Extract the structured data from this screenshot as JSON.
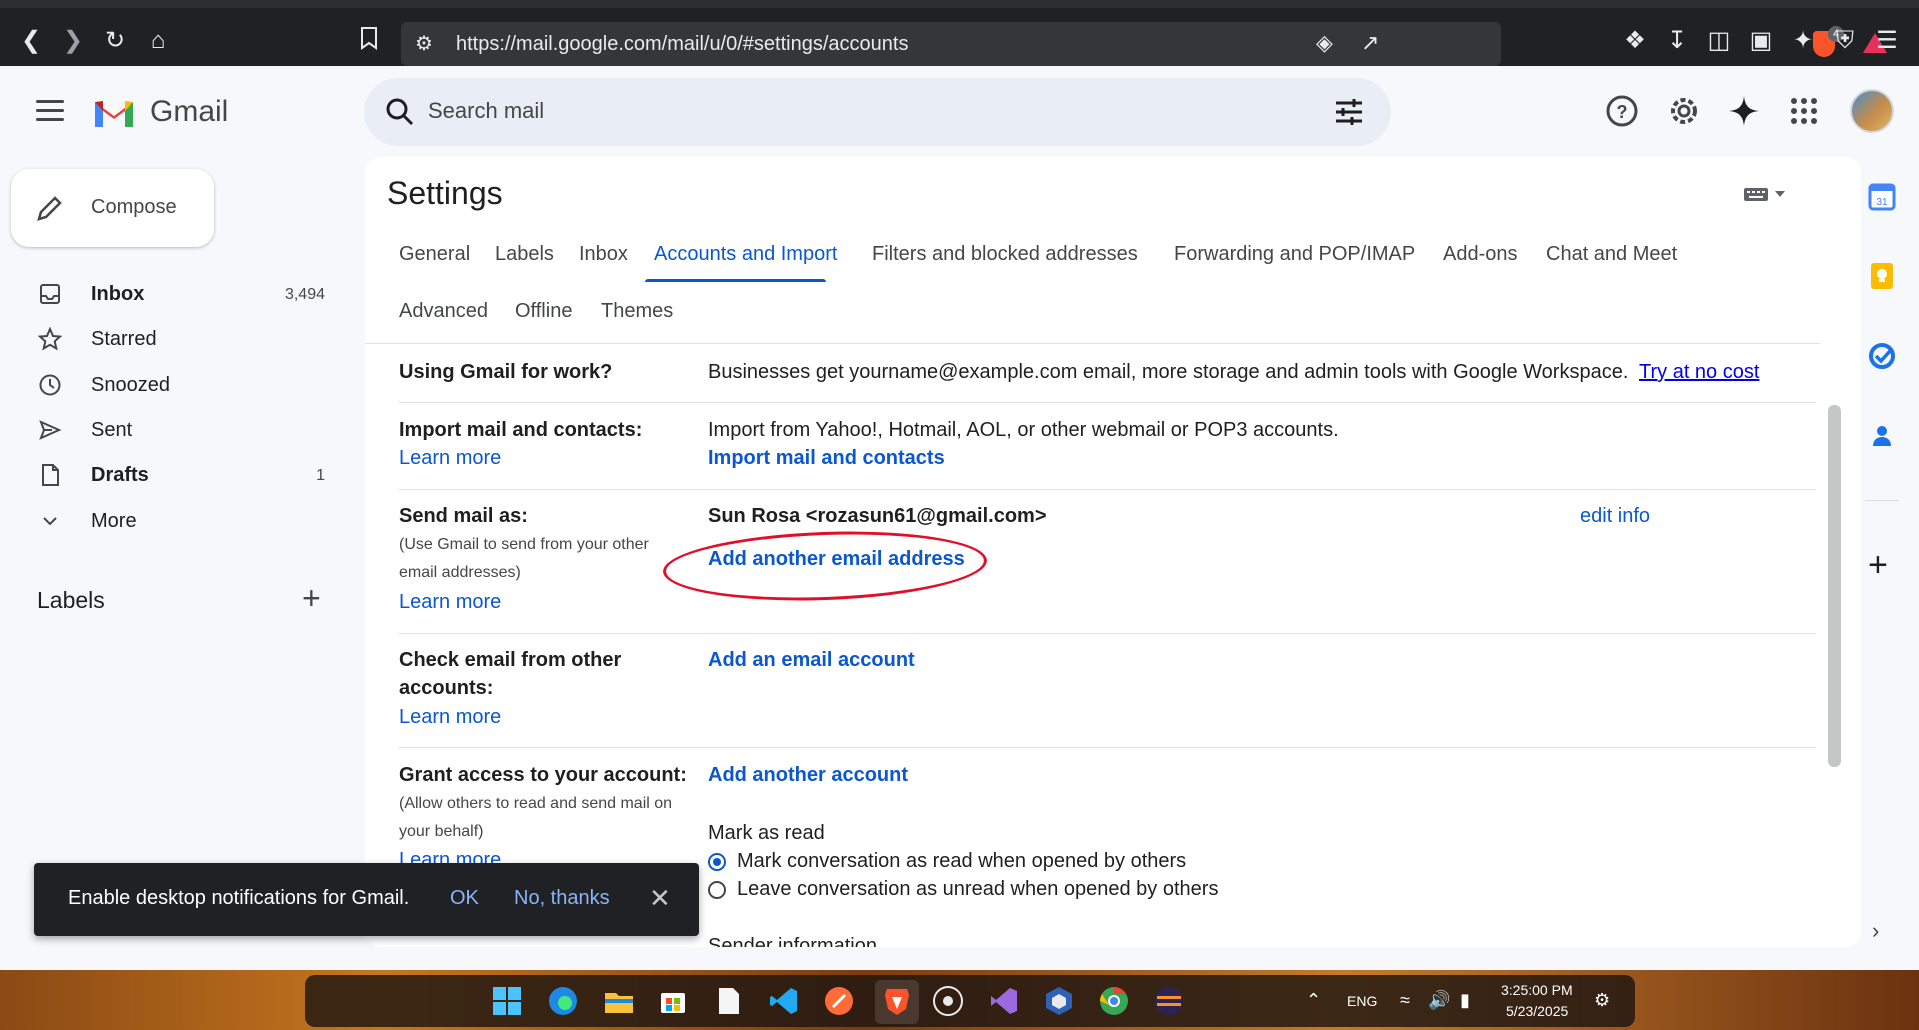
{
  "browser": {
    "url": "https://mail.google.com/mail/u/0/#settings/accounts",
    "shield_count": "4"
  },
  "header": {
    "app_name": "Gmail",
    "search_placeholder": "Search mail"
  },
  "sidebar": {
    "compose_label": "Compose",
    "items": [
      {
        "label": "Inbox",
        "count": "3,494"
      },
      {
        "label": "Starred",
        "count": ""
      },
      {
        "label": "Snoozed",
        "count": ""
      },
      {
        "label": "Sent",
        "count": ""
      },
      {
        "label": "Drafts",
        "count": "1"
      },
      {
        "label": "More",
        "count": ""
      }
    ],
    "labels_heading": "Labels"
  },
  "settings": {
    "title": "Settings",
    "tabs": [
      "General",
      "Labels",
      "Inbox",
      "Accounts and Import",
      "Filters and blocked addresses",
      "Forwarding and POP/IMAP",
      "Add-ons",
      "Chat and Meet",
      "Advanced",
      "Offline",
      "Themes"
    ],
    "active_tab": "Accounts and Import",
    "rows": {
      "work": {
        "label": "Using Gmail for work?",
        "text": "Businesses get yourname@example.com email, more storage and admin tools with Google Workspace.",
        "link": "Try at no cost"
      },
      "import": {
        "label": "Import mail and contacts:",
        "learn": "Learn more",
        "text": "Import from Yahoo!, Hotmail, AOL, or other webmail or POP3 accounts.",
        "action": "Import mail and contacts"
      },
      "send_as": {
        "label": "Send mail as:",
        "sub1": "(Use Gmail to send from your other",
        "sub2": "email addresses)",
        "learn": "Learn more",
        "identity": "Sun Rosa <rozasun61@gmail.com>",
        "edit": "edit info",
        "action": "Add another email address"
      },
      "check": {
        "label1": "Check email from other",
        "label2": "accounts:",
        "learn": "Learn more",
        "action": "Add an email account"
      },
      "grant": {
        "label": "Grant access to your account:",
        "sub1": "(Allow others to read and send mail on",
        "sub2": "your behalf)",
        "learn": "Learn more",
        "action": "Add another account",
        "mark_heading": "Mark as read",
        "option1": "Mark conversation as read when opened by others",
        "option2": "Leave conversation as unread when opened by others",
        "selected": "option1",
        "sender_heading": "Sender information"
      }
    }
  },
  "toast": {
    "message": "Enable desktop notifications for Gmail.",
    "ok": "OK",
    "no": "No, thanks"
  },
  "taskbar": {
    "lang": "ENG",
    "time": "3:25:00 PM",
    "date": "5/23/2025"
  },
  "colors": {
    "accent": "#0b57d0",
    "annotation": "#e0102a"
  }
}
